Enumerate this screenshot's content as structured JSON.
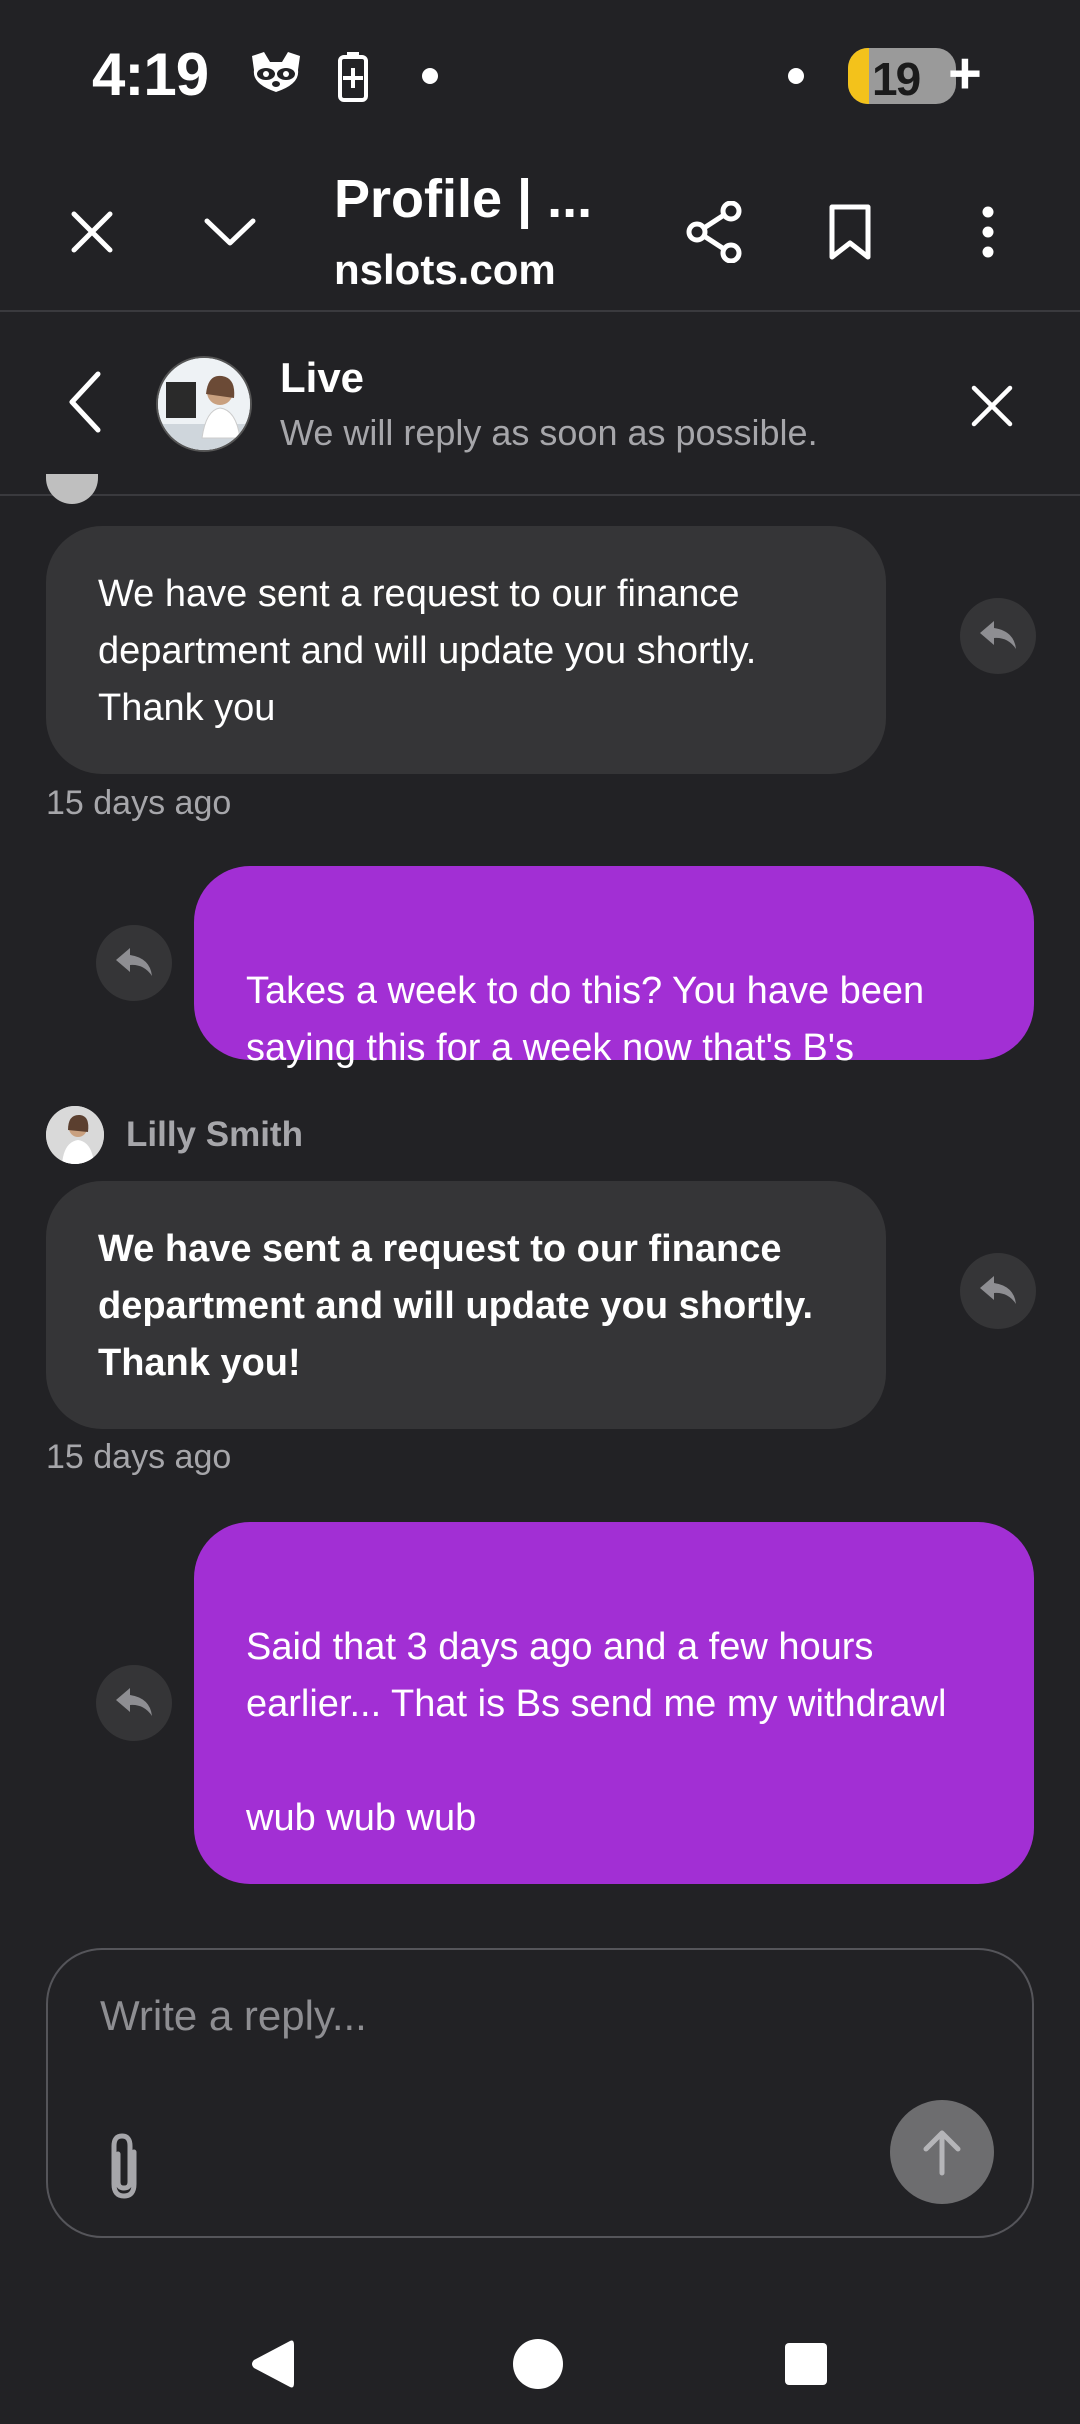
{
  "status_bar": {
    "time": "4:19",
    "battery_level": "19",
    "battery_fraction": 0.19,
    "icons": [
      "raccoon-icon",
      "battery-saver-icon",
      "notification-dot-icon",
      "notification-dot-icon",
      "charging-plus-icon"
    ]
  },
  "browser": {
    "title": "Profile | ...",
    "url": "nslots.com",
    "icons": [
      "close-icon",
      "chevron-down-icon",
      "share-icon",
      "bookmark-icon",
      "more-vertical-icon"
    ]
  },
  "chat_header": {
    "name": "Live",
    "subtitle": "We will reply as soon as possible."
  },
  "messages": [
    {
      "from": "agent",
      "text": "We have sent a request to our finance department and will update you shortly. Thank you",
      "time": "15 days ago"
    },
    {
      "from": "user",
      "text": "Takes a week to do this? You have been saying this for a week now that's B's"
    },
    {
      "from": "agent",
      "sender": "Lilly Smith",
      "text": "We have sent a request to our finance department and will update you shortly. Thank you!",
      "time": "15 days ago"
    },
    {
      "from": "user",
      "text": "Said that 3 days ago and a few hours earlier... That is Bs send me my withdrawl\n\nwub wub wub"
    }
  ],
  "reply": {
    "placeholder": "Write a reply..."
  },
  "colors": {
    "background": "#222225",
    "agent_bubble": "#353537",
    "user_bubble": "#a22fd4",
    "muted_text": "#a6a6aa",
    "battery_accent": "#f3c21b"
  }
}
